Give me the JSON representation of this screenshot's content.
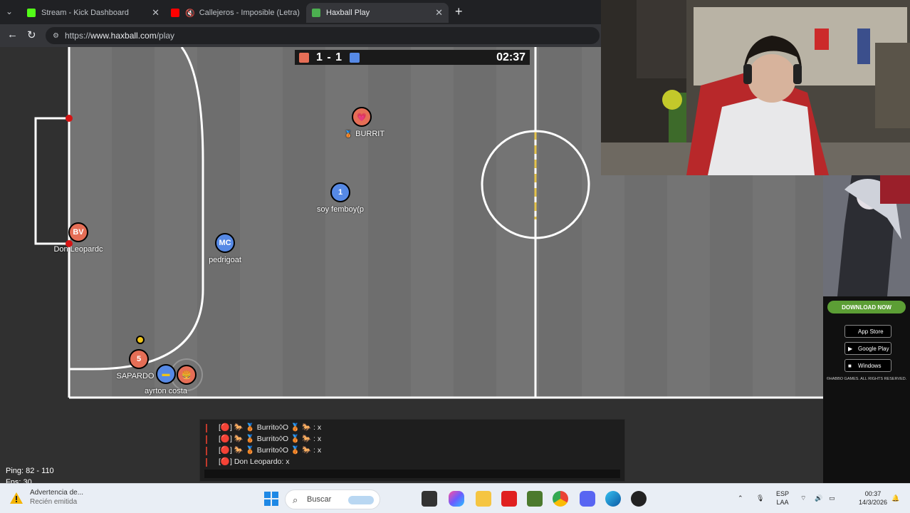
{
  "browser": {
    "tabs": [
      {
        "title": "Stream - Kick Dashboard",
        "favicon_color": "#53fc18",
        "active": false
      },
      {
        "title": "Callejeros - Imposible (Letra)",
        "favicon_color": "#ff0000",
        "active": false
      },
      {
        "title": "Haxball Play",
        "favicon_color": "#4caf50",
        "active": true
      }
    ],
    "close_glyph": "✕",
    "new_tab_glyph": "+",
    "url_scheme": "https://",
    "url_host": "www.haxball.com",
    "url_path": "/play"
  },
  "game": {
    "score": "1 - 1",
    "clock": "02:37",
    "players": [
      {
        "name": "BURRIT",
        "team": "red",
        "avatar": "💗"
      },
      {
        "name": "soy femboy(p",
        "team": "blue",
        "avatar": "1"
      },
      {
        "name": "Don Leopardc",
        "team": "red",
        "avatar": "BV"
      },
      {
        "name": "pedrigoat",
        "team": "blue",
        "avatar": "MC"
      },
      {
        "name": "SAPARDO",
        "team": "red",
        "avatar": "5"
      },
      {
        "name": "ayrton costa",
        "team": "blue",
        "avatar": "▬"
      },
      {
        "name": "",
        "team": "red",
        "avatar": "🍔"
      }
    ],
    "ping": "Ping: 82 - 110",
    "fps": "Fps: 30",
    "chat": [
      "[🔴] 🐎 🥉 Burrito◊O 🥉 🐎 : x",
      "[🔴] 🐎 🥉 Burrito◊O 🥉 🐎 : x",
      "[🔴] 🐎 🥉 Burrito◊O 🥉 🐎 : x",
      "[🔴] Don Leopardo: x"
    ],
    "colors": {
      "red": "#e56e56",
      "blue": "#5689e5",
      "field": "#303030",
      "ball": "#f0c419"
    }
  },
  "ad": {
    "download_label": "DOWNLOAD NOW",
    "app_store": "App Store",
    "google_play": "Google Play",
    "windows": "Windows",
    "footer": "©HABBO GAMES. ALL RIGHTS RESERVED."
  },
  "taskbar": {
    "notification_title": "Advertencia de...",
    "notification_sub": "Recién emitida",
    "search_placeholder": "Buscar",
    "lang_top": "ESP",
    "lang_bottom": "LAA",
    "time": "00:37",
    "date": "14/3/2026"
  }
}
